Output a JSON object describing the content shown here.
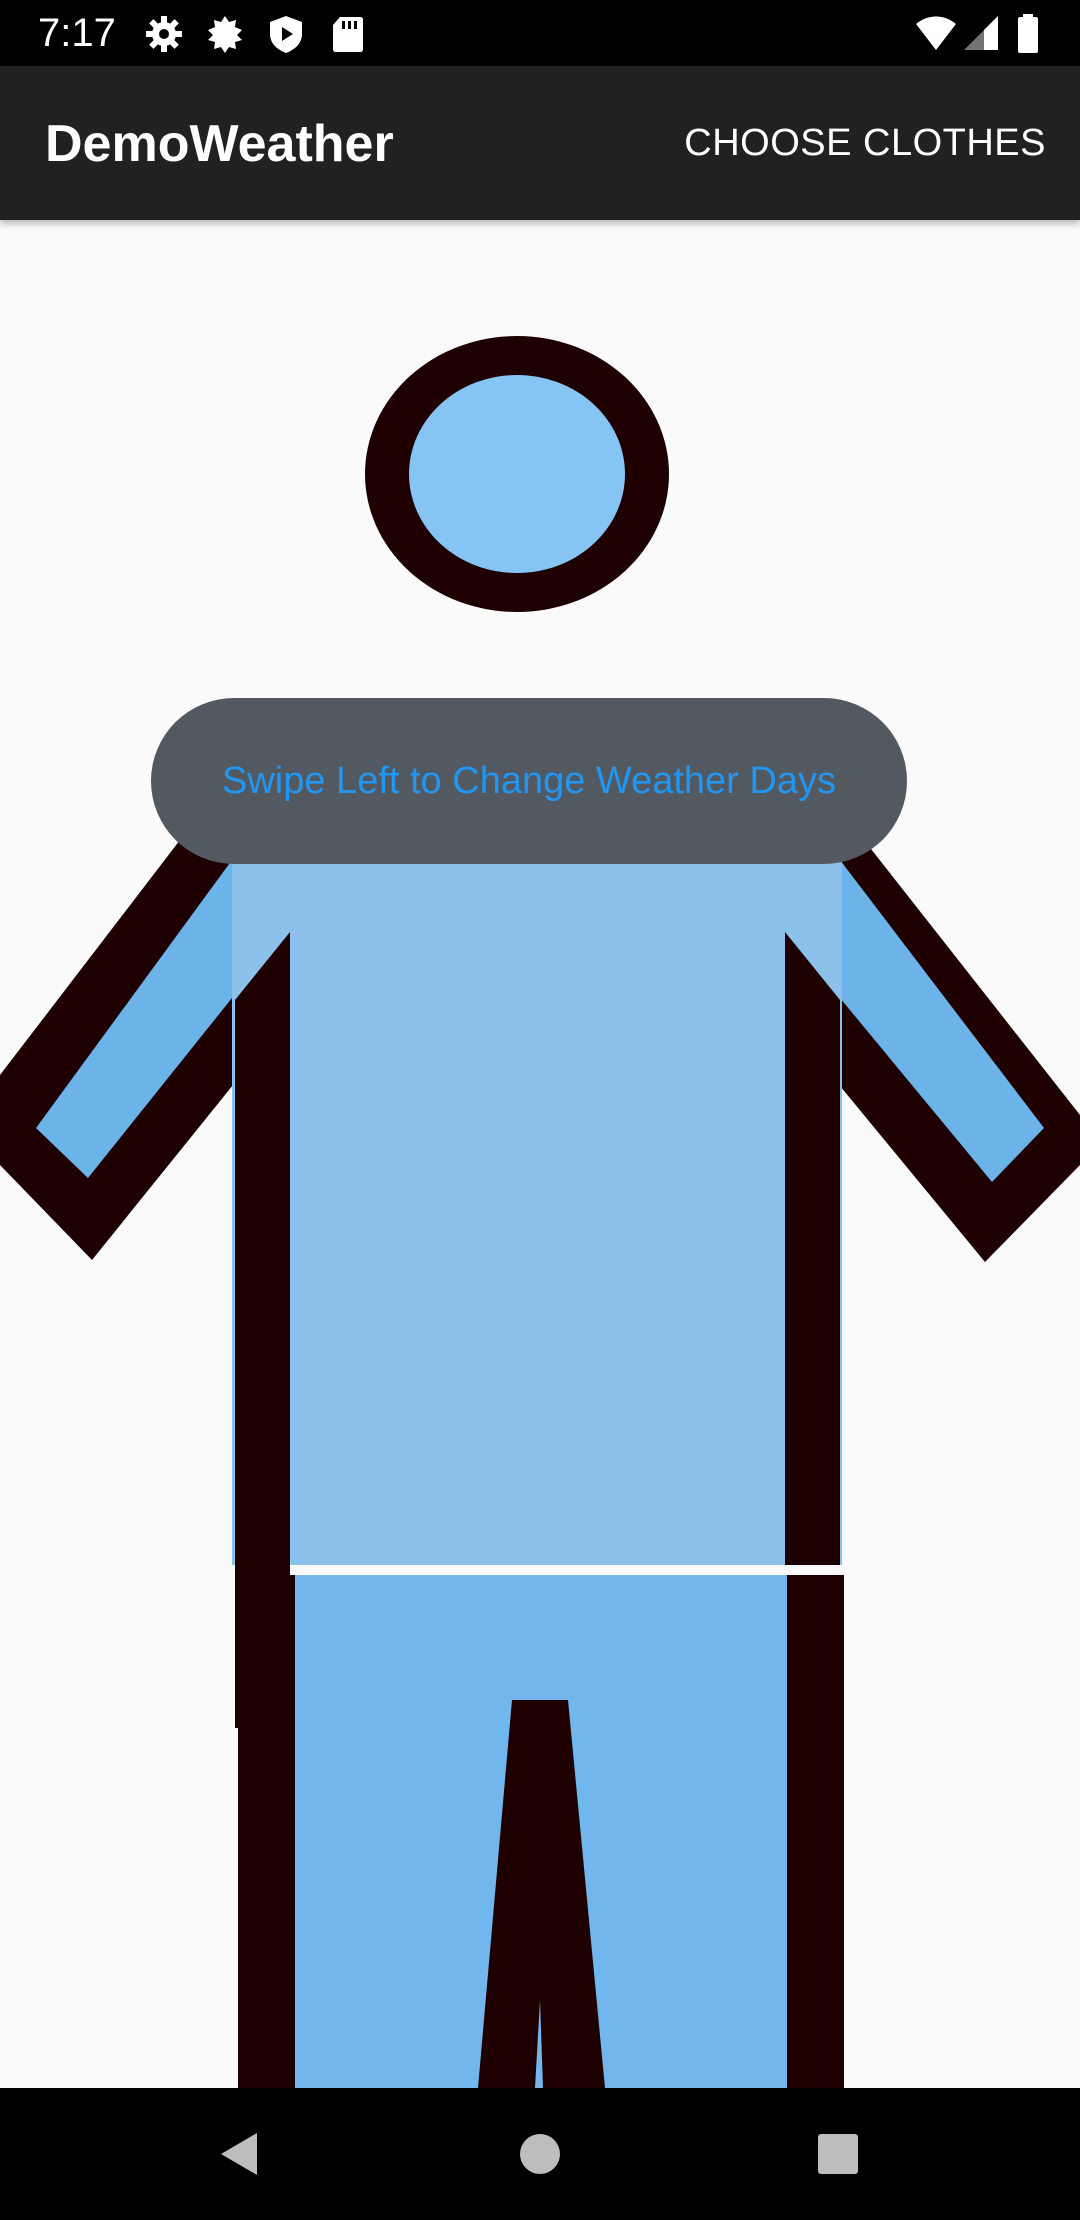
{
  "status_bar": {
    "time": "7:17",
    "icons": [
      "settings-icon",
      "brightness-icon",
      "shield-play-icon",
      "sd-card-icon",
      "wifi-icon",
      "signal-icon",
      "battery-icon"
    ]
  },
  "app_bar": {
    "title": "DemoWeather",
    "action_label": "CHOOSE CLOTHES"
  },
  "toast": {
    "message": "Swipe Left to Change Weather Days"
  },
  "figure": {
    "outline_color": "#1e0000",
    "head_color": "#86c4f4",
    "shirt_color": "#8bc1ea",
    "sleeve_color": "#6cb3e9",
    "pants_color": "#71b7ed"
  },
  "nav_bar": {
    "icons": [
      "back-icon",
      "home-icon",
      "recents-icon"
    ]
  },
  "colors": {
    "status_bar_bg": "#000000",
    "app_bar_bg": "#212121",
    "toast_bg": "#535961",
    "toast_text": "#2196f3",
    "content_bg": "#fafafa"
  }
}
